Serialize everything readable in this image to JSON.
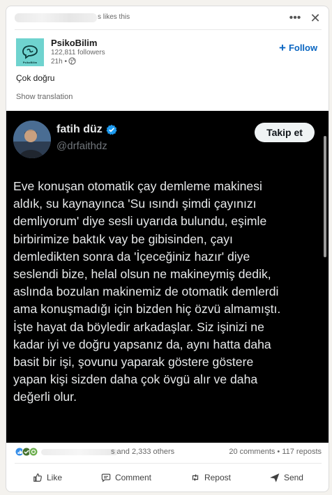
{
  "header": {
    "likes_suffix": "s likes this",
    "more_icon": "ellipsis-icon",
    "close_icon": "close-icon"
  },
  "author": {
    "name": "PsikoBilim",
    "followers": "122,811 followers",
    "time": "21h •",
    "logo_text": "PsikoBilim",
    "follow_label": "Follow",
    "follow_plus": "+"
  },
  "post": {
    "text": "Çok doğru",
    "show_translation": "Show translation"
  },
  "tweet": {
    "name": "fatih düz",
    "handle": "@drfaithdz",
    "follow_button": "Takip et",
    "lines": [
      "Eve konuşan otomatik çay demleme makinesi",
      "aldık, su kaynayınca 'Su ısındı şimdi çayınızı",
      "demliyorum' diye sesli uyarıda bulundu, eşimle",
      "birbirimize baktık vay be gibisinden, çayı",
      "demledikten sonra da 'İçeceğiniz hazır' diye",
      "seslendi bize, helal olsun ne makineymiş dedik,",
      "aslında bozulan makinemiz de otomatik demlerdi",
      "ama konuşmadığı için bizden hiç özvü almamıştı.",
      "İşte hayat da böyledir arkadaşlar. Siz işinizi ne",
      "kadar iyi ve doğru yapsanız da, aynı hatta daha",
      "basit bir işi, şovunu yaparak göstere göstere",
      "yapan kişi sizden daha çok övgü alır ve daha",
      "değerli olur."
    ]
  },
  "social": {
    "reactors_suffix": "s and 2,333 others",
    "counts": "20 comments • 117 reposts"
  },
  "actions": {
    "like": "Like",
    "comment": "Comment",
    "repost": "Repost",
    "send": "Send"
  },
  "colors": {
    "accent": "#0a66c2",
    "tweet_bg": "#000000",
    "verified": "#1d9bf0",
    "logo_bg": "#6fd3cf"
  }
}
